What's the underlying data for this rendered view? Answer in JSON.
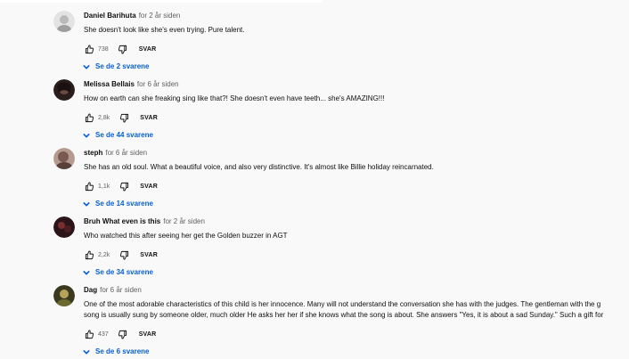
{
  "comments": [
    {
      "author": "Daniel Barihuta",
      "time": "for 2 år siden",
      "text": "She doesn't look like she's even trying. Pure talent.",
      "likes": "738",
      "reply_label": "SVAR",
      "replies_label": "Se de 2 svarene",
      "avatar_color": "#d0d0d0"
    },
    {
      "author": "Melissa Bellais",
      "time": "for 6 år siden",
      "text": "How on earth can she freaking sing like that?! She doesn't even have teeth... she's AMAZING!!!",
      "likes": "2,8k",
      "reply_label": "SVAR",
      "replies_label": "Se de 44 svarene",
      "avatar_color": "#2a1e1c"
    },
    {
      "author": "steph",
      "time": "for 6 år siden",
      "text": "She has an old soul. What a beautiful voice, and also very distinctive. It's almost like Billie holiday reincarnated.",
      "likes": "1,1k",
      "reply_label": "SVAR",
      "replies_label": "Se de 14 svarene",
      "avatar_color": "#8a6a63"
    },
    {
      "author": "Bruh What even is this",
      "time": "for 2 år siden",
      "text": "Who watched this after seeing her get the Golden buzzer in AGT",
      "likes": "2,2k",
      "reply_label": "SVAR",
      "replies_label": "Se de 34 svarene",
      "avatar_color": "#2b1518"
    },
    {
      "author": "Dag",
      "time": "for 6 år siden",
      "text": "One of the most adorable characteristics of this child is her innocence. Many will not  understand the conversation she has with the judges. The gentleman with the g",
      "text2": "song is usually sung by someone older, much older He asks her  her if she knows what the song is about. She answers \"Yes,  it is about a sad Sunday.\" Such a gift for",
      "likes": "437",
      "reply_label": "SVAR",
      "replies_label": "Se de 6 svarene",
      "avatar_color": "#3b3a1e"
    }
  ]
}
